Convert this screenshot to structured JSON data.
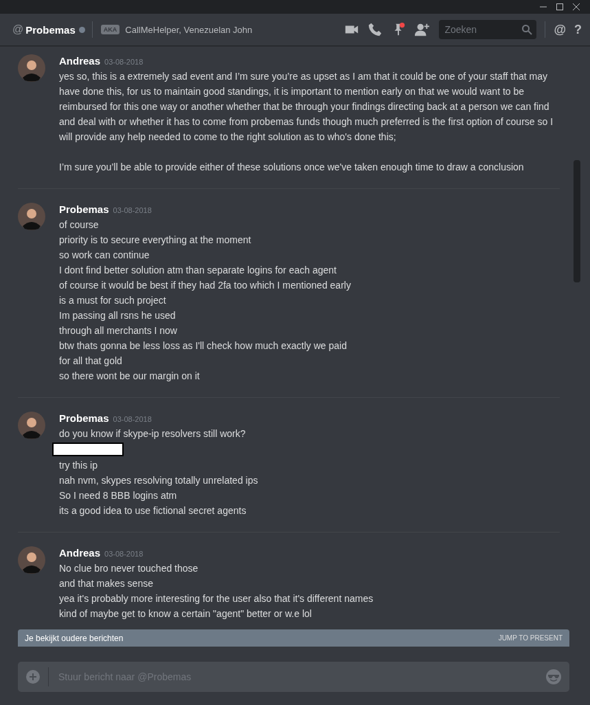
{
  "header": {
    "at": "@",
    "title": "Probemas",
    "aka_badge": "AKA",
    "aka_names": "CallMeHelper, Venezuelan John",
    "search": {
      "placeholder": "Zoeken"
    },
    "mention_symbol": "@",
    "help_symbol": "?"
  },
  "messages": [
    {
      "author": "Andreas",
      "time": "03-08-2018",
      "lines": [
        {
          "kind": "paragraph",
          "text": "yes so, this is a extremely sad event and I’m sure you’re as upset as I am that it could be one of your staff that may have done this, for us to maintain good standings, it is important to mention early on that we would want to be reimbursed for this one way or another whether that be through your findings directing back at a person we can find and deal with or whether it has to come from probemas funds though much preferred is the first option of course so I will provide any help needed to come to the right solution as to who's done this;"
        },
        {
          "kind": "paragraph",
          "text": "I’m sure you’ll be able to provide either of these solutions once we've taken enough time to draw a conclusion"
        }
      ]
    },
    {
      "author": "Probemas",
      "time": "03-08-2018",
      "lines": [
        {
          "kind": "line",
          "text": "of course"
        },
        {
          "kind": "line",
          "text": "priority is to secure everything at the moment"
        },
        {
          "kind": "line",
          "text": "so work can continue"
        },
        {
          "kind": "line",
          "text": "I dont find better solution atm than separate logins for each agent"
        },
        {
          "kind": "line",
          "text": "of course it would be best if they had 2fa too which I mentioned early"
        },
        {
          "kind": "line",
          "text": "is a must for such project"
        },
        {
          "kind": "line",
          "text": "Im passing all rsns he used"
        },
        {
          "kind": "line",
          "text": "through all merchants I now"
        },
        {
          "kind": "line",
          "text": "btw thats gonna be less loss as I'll check how much exactly we paid"
        },
        {
          "kind": "line",
          "text": "for all that gold"
        },
        {
          "kind": "line",
          "text": "so there wont be our margin on it"
        }
      ]
    },
    {
      "author": "Probemas",
      "time": "03-08-2018",
      "lines": [
        {
          "kind": "line",
          "text": "do you know if skype-ip resolvers still work?"
        },
        {
          "kind": "redacted"
        },
        {
          "kind": "line",
          "text": "try this ip"
        },
        {
          "kind": "line",
          "text": "nah nvm, skypes resolving totally unrelated ips"
        },
        {
          "kind": "line",
          "text": "So I need 8 BBB logins atm"
        },
        {
          "kind": "line",
          "text": "its a good idea to use fictional secret agents"
        }
      ]
    },
    {
      "author": "Andreas",
      "time": "03-08-2018",
      "lines": [
        {
          "kind": "line",
          "text": "No clue bro never touched those"
        },
        {
          "kind": "line",
          "text": "and that makes sense"
        },
        {
          "kind": "line",
          "text": "yea it's probably more interesting for the user also that it's different names"
        },
        {
          "kind": "line",
          "text": "kind of maybe get to know a certain \"agent\" better or w.e lol"
        }
      ]
    }
  ],
  "older_bar": {
    "text": "Je bekijkt oudere berichten",
    "action": "JUMP TO PRESENT"
  },
  "composer": {
    "placeholder": "Stuur bericht naar @Probemas"
  }
}
